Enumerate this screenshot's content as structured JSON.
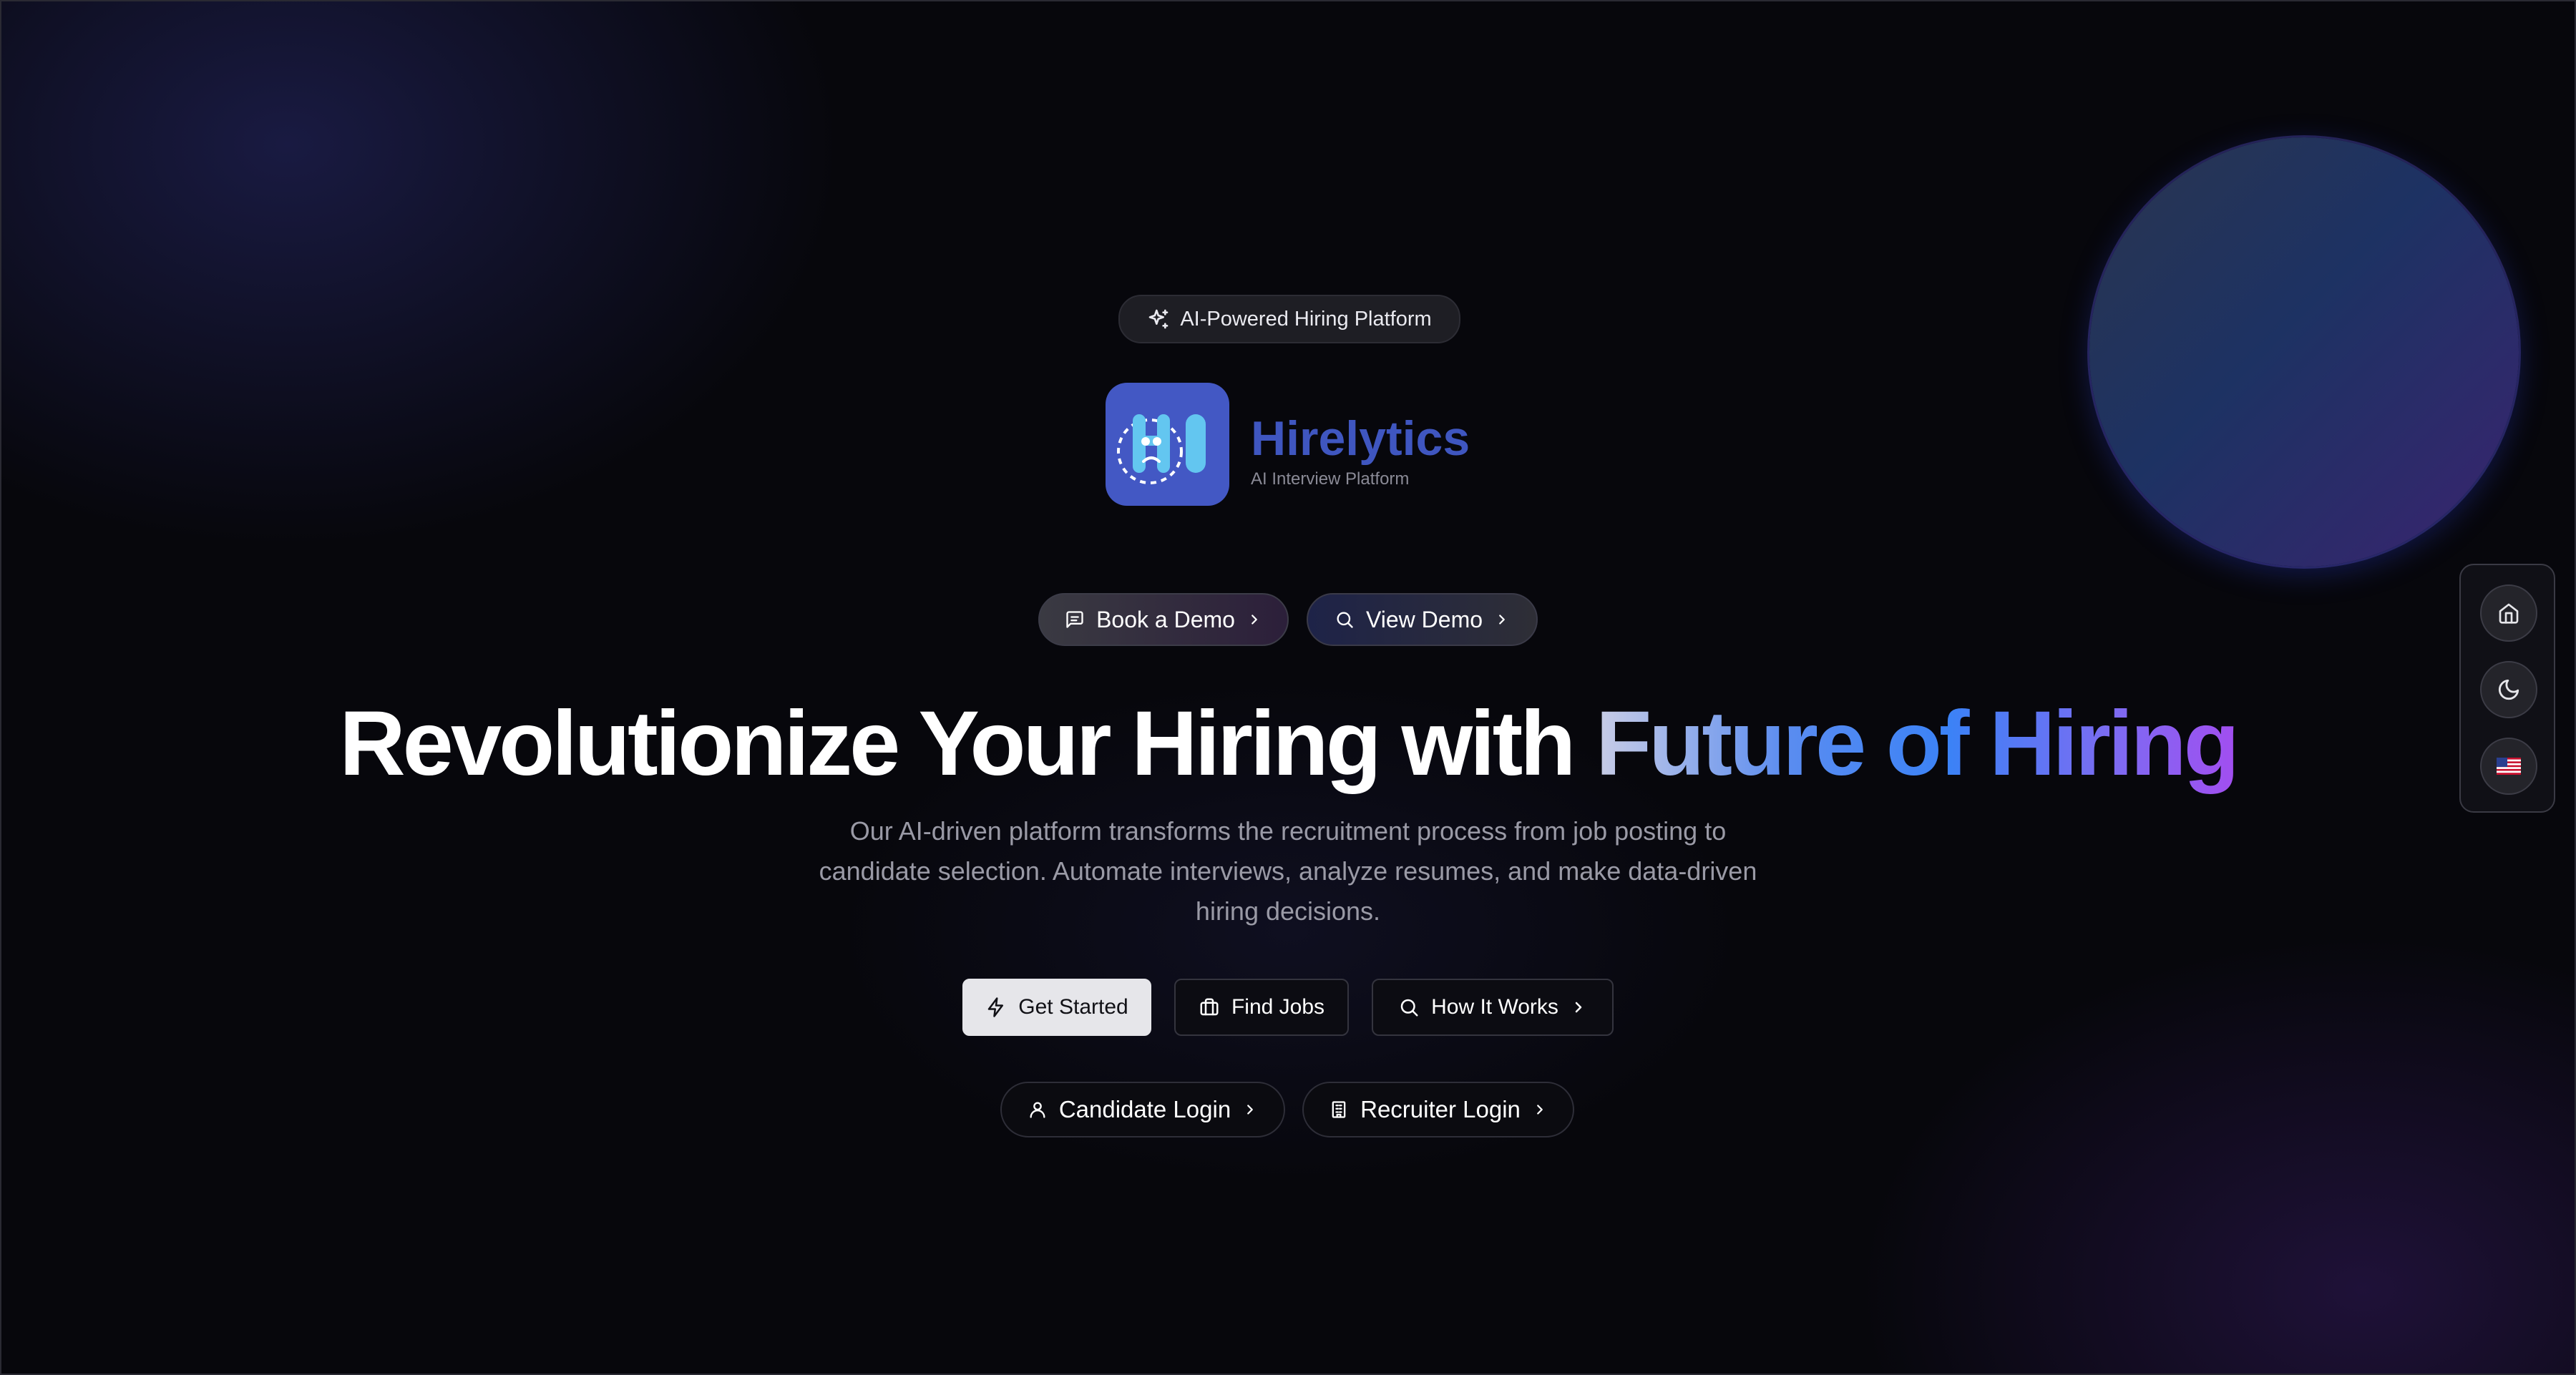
{
  "badge": {
    "icon": "sparkles-icon",
    "label": "AI-Powered Hiring Platform"
  },
  "brand": {
    "logo_icon": "hirelytics-logo-icon",
    "name": "Hirelytics",
    "tagline": "AI Interview Platform",
    "color": "#3f56c0",
    "logo_bg": "#4358c4"
  },
  "demo_buttons": {
    "book": {
      "icon": "message-square-icon",
      "label": "Book a Demo"
    },
    "view": {
      "icon": "search-icon",
      "label": "View Demo"
    }
  },
  "hero": {
    "headline_plain": "Revolutionize Your Hiring with",
    "headline_highlight": "Future of Hiring",
    "description": "Our AI-driven platform transforms the recruitment process from job posting to candidate selection. Automate interviews, analyze resumes, and make data-driven hiring decisions."
  },
  "cta": {
    "get_started": {
      "icon": "zap-icon",
      "label": "Get Started"
    },
    "find_jobs": {
      "icon": "briefcase-icon",
      "label": "Find Jobs"
    },
    "how_it_works": {
      "icon": "search-icon",
      "label": "How It Works"
    }
  },
  "logins": {
    "candidate": {
      "icon": "user-icon",
      "label": "Candidate Login"
    },
    "recruiter": {
      "icon": "building-icon",
      "label": "Recruiter Login"
    }
  },
  "side_panel": {
    "home": {
      "icon": "home-icon"
    },
    "theme": {
      "icon": "moon-icon"
    },
    "language": {
      "icon": "us-flag-icon",
      "flag": "🇺🇸"
    }
  },
  "colors": {
    "background": "#07070c",
    "accent_blue": "#3b82f6",
    "accent_purple": "#a24ef0"
  }
}
